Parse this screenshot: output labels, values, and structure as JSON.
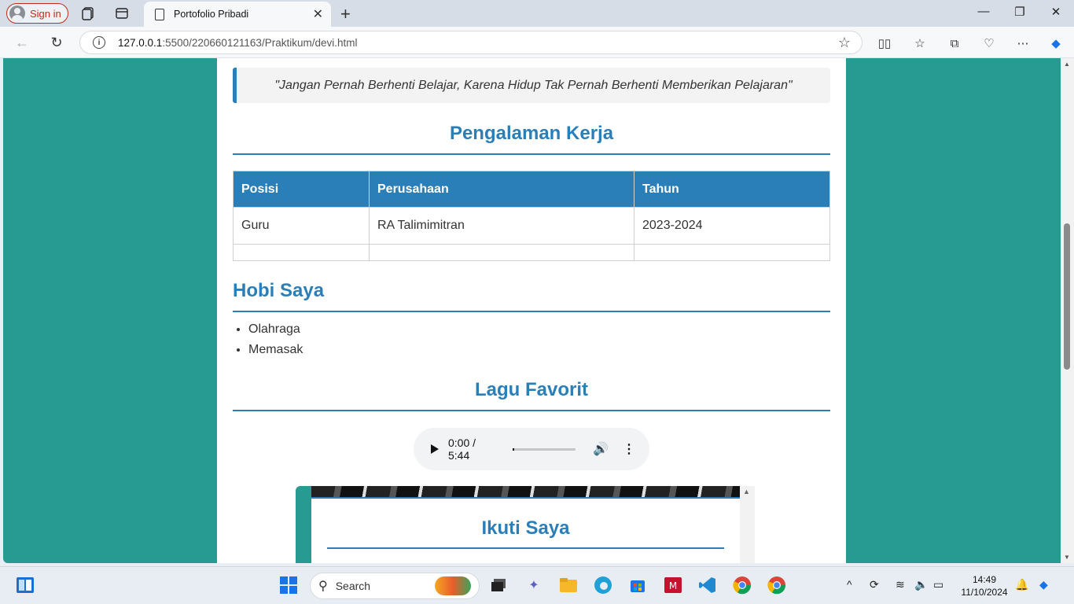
{
  "browser": {
    "signin_label": "Sign in",
    "tab_title": "Portofolio Pribadi",
    "tab_close": "✕",
    "new_tab": "+",
    "url_host": "127.0.0.1",
    "url_path": ":5500/220660121163/Praktikum/devi.html"
  },
  "page": {
    "quote": "\"Jangan Pernah Berhenti Belajar, Karena Hidup Tak Pernah Berhenti Memberikan Pelajaran\"",
    "experience": {
      "title": "Pengalaman Kerja",
      "headers": [
        "Posisi",
        "Perusahaan",
        "Tahun"
      ],
      "rows": [
        [
          "Guru",
          "RA Talimimitran",
          "2023-2024"
        ],
        [
          "",
          "",
          ""
        ]
      ]
    },
    "hobbies": {
      "title": "Hobi Saya",
      "items": [
        "Olahraga",
        "Memasak"
      ]
    },
    "music": {
      "title": "Lagu Favorit",
      "time": "0:00 / 5:44",
      "progress": 0.0
    },
    "follow": {
      "title": "Ikuti Saya"
    }
  },
  "taskbar": {
    "search_placeholder": "Search",
    "time": "14:49",
    "date": "11/10/2024"
  },
  "colors": {
    "accent": "#2b7fb8",
    "page_bg": "#279b92"
  }
}
